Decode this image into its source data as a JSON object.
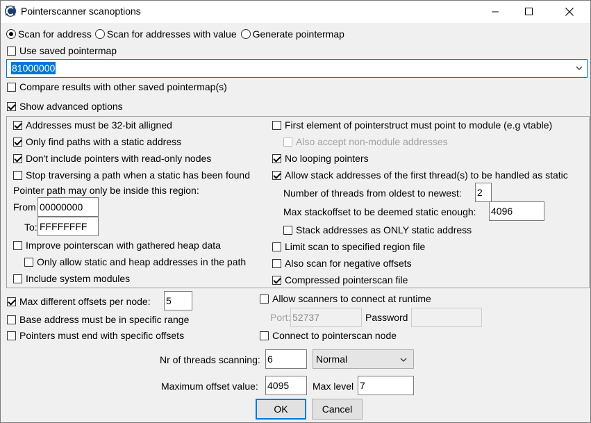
{
  "window": {
    "title": "Pointerscanner scanoptions"
  },
  "scan_mode": {
    "options": [
      "Scan for address",
      "Scan for addresses with value",
      "Generate pointermap"
    ],
    "selected": "Scan for address"
  },
  "use_saved_pointermap": {
    "label": "Use saved pointermap",
    "checked": false
  },
  "address_combo": {
    "value": "81000000"
  },
  "compare_results": {
    "label": "Compare results with other saved pointermap(s)",
    "checked": false
  },
  "show_advanced": {
    "label": "Show advanced options",
    "checked": true
  },
  "advanced": {
    "left": {
      "aligned32": {
        "label": "Addresses must be 32-bit alligned",
        "checked": true
      },
      "static_only": {
        "label": "Only find paths with a static address",
        "checked": true
      },
      "no_readonly": {
        "label": "Don't include pointers with read-only nodes",
        "checked": true
      },
      "stop_static": {
        "label": "Stop traversing a path when a static has been found",
        "checked": false
      },
      "region_label": "Pointer path may only be inside this region:",
      "from_label": "From",
      "from_value": "00000000",
      "to_label": "To:",
      "to_value": "FFFFFFFF",
      "heap_data": {
        "label": "Improve pointerscan with gathered heap data",
        "checked": false
      },
      "static_heap_only": {
        "label": "Only allow static and heap addresses in the path",
        "checked": false
      },
      "system_modules": {
        "label": "Include system modules",
        "checked": false
      }
    },
    "right": {
      "first_element_module": {
        "label": "First element of pointerstruct must point to module (e.g vtable)",
        "checked": false
      },
      "non_module": {
        "label": "Also accept non-module addresses",
        "checked": false
      },
      "no_looping": {
        "label": "No looping pointers",
        "checked": true
      },
      "stack_addresses": {
        "label": "Allow stack addresses of the first thread(s) to be handled as static",
        "checked": true
      },
      "threads_label": "Number of threads from oldest to newest:",
      "threads_value": "2",
      "stackoffset_label": "Max stackoffset to be deemed static enough:",
      "stackoffset_value": "4096",
      "stack_only": {
        "label": "Stack addresses as ONLY static address",
        "checked": false
      },
      "limit_region": {
        "label": "Limit scan to specified region file",
        "checked": false
      },
      "negative_offsets": {
        "label": "Also scan for negative offsets",
        "checked": false
      },
      "compressed": {
        "label": "Compressed pointerscan file",
        "checked": true
      }
    }
  },
  "bottom": {
    "max_offsets": {
      "label": "Max different offsets per node:",
      "checked": true,
      "value": "5"
    },
    "base_range": {
      "label": "Base address must be in specific range",
      "checked": false
    },
    "end_offsets": {
      "label": "Pointers must end with specific offsets",
      "checked": false
    },
    "allow_scanners": {
      "label": "Allow scanners to connect at runtime",
      "checked": false
    },
    "port_label": "Port:",
    "port_value": "52737",
    "password_label": "Password",
    "password_value": "",
    "connect_node": {
      "label": "Connect to pointerscan node",
      "checked": false
    },
    "threads_label": "Nr of threads scanning:",
    "threads_value": "6",
    "priority_value": "Normal",
    "max_offset_label": "Maximum offset value:",
    "max_offset_value": "4095",
    "max_level_label": "Max level",
    "max_level_value": "7"
  },
  "buttons": {
    "ok": "OK",
    "cancel": "Cancel"
  }
}
